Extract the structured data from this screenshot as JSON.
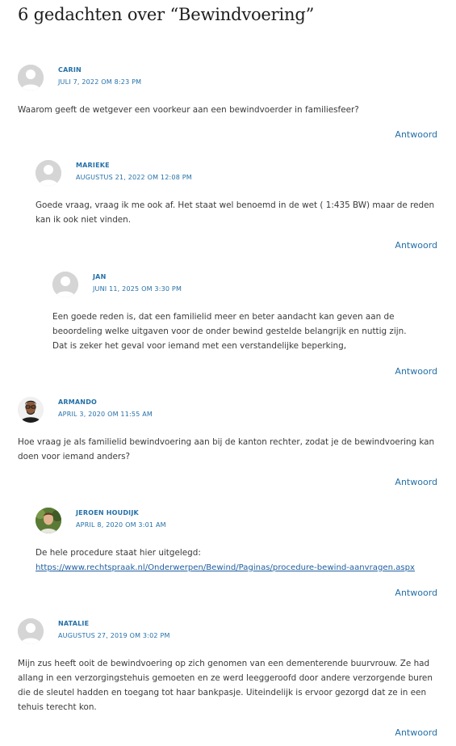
{
  "heading": "6 gedachten over “Bewindvoering”",
  "reply_label": "Antwoord",
  "comments": [
    {
      "author": "CARIN",
      "date": "JULI 7, 2022 OM 8:23 PM",
      "lines": [
        "Waarom geeft de wetgever een voorkeur aan een bewindvoerder in familiesfeer?"
      ]
    },
    {
      "author": "MARIEKE",
      "date": "AUGUSTUS 21, 2022 OM 12:08 PM",
      "lines": [
        "Goede vraag, vraag ik me ook af. Het staat wel benoemd in de wet ( 1:435 BW) maar de reden",
        "kan ik ook niet vinden."
      ]
    },
    {
      "author": "JAN",
      "date": "JUNI 11, 2025 OM 3:30 PM",
      "lines": [
        "Een goede reden is, dat een familielid meer en beter aandacht kan geven aan de",
        "beoordeling welke uitgaven voor de onder bewind gestelde belangrijk en nuttig zijn.",
        "Dat is zeker het geval voor iemand met een verstandelijke beperking,"
      ]
    },
    {
      "author": "ARMANDO",
      "date": "APRIL 3, 2020 OM 11:55 AM",
      "lines": [
        "Hoe vraag je als familielid bewindvoering aan bij de kanton rechter, zodat je de bewindvoering kan",
        "doen voor iemand anders?"
      ]
    },
    {
      "author": "JEROEN HOUDIJK",
      "date": "APRIL 8, 2020 OM 3:01 AM",
      "lines": [
        "De hele procedure staat hier uitgelegd:"
      ],
      "link": "https://www.rechtspraak.nl/Onderwerpen/Bewind/Paginas/procedure-bewind-aanvragen.aspx"
    },
    {
      "author": "NATALIE",
      "date": "AUGUSTUS 27, 2019 OM 3:02 PM",
      "lines": [
        "Mijn zus heeft ooit de bewindvoering op zich genomen van een dementerende buurvrouw. Ze had",
        "allang in een verzorgingstehuis gemoeten en ze werd leeggeroofd door andere verzorgende buren",
        "die de sleutel hadden en toegang tot haar bankpasje. Uiteindelijk is ervoor gezorgd dat ze in een",
        "tehuis terecht kon."
      ]
    }
  ],
  "avatars": [
    "generic-avatar-icon",
    "generic-avatar-icon",
    "generic-avatar-icon",
    "armando-photo",
    "jeroen-photo",
    "generic-avatar-icon"
  ],
  "colors": {
    "accent": "#2470a8",
    "text": "#3a3a3a",
    "heading": "#1e1e1e"
  }
}
